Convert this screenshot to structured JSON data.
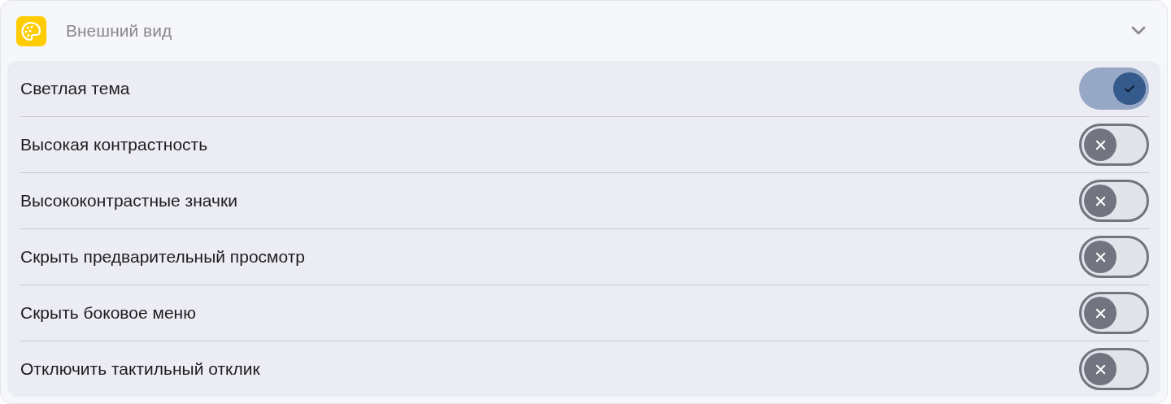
{
  "section": {
    "title": "Внешний вид",
    "expanded": true
  },
  "settings": [
    {
      "label": "Светлая тема",
      "on": true
    },
    {
      "label": "Высокая контрастность",
      "on": false
    },
    {
      "label": "Высококонтрастные значки",
      "on": false
    },
    {
      "label": "Скрыть предварительный просмотр",
      "on": false
    },
    {
      "label": "Скрыть боковое меню",
      "on": false
    },
    {
      "label": "Отключить тактильный отклик",
      "on": false
    }
  ]
}
